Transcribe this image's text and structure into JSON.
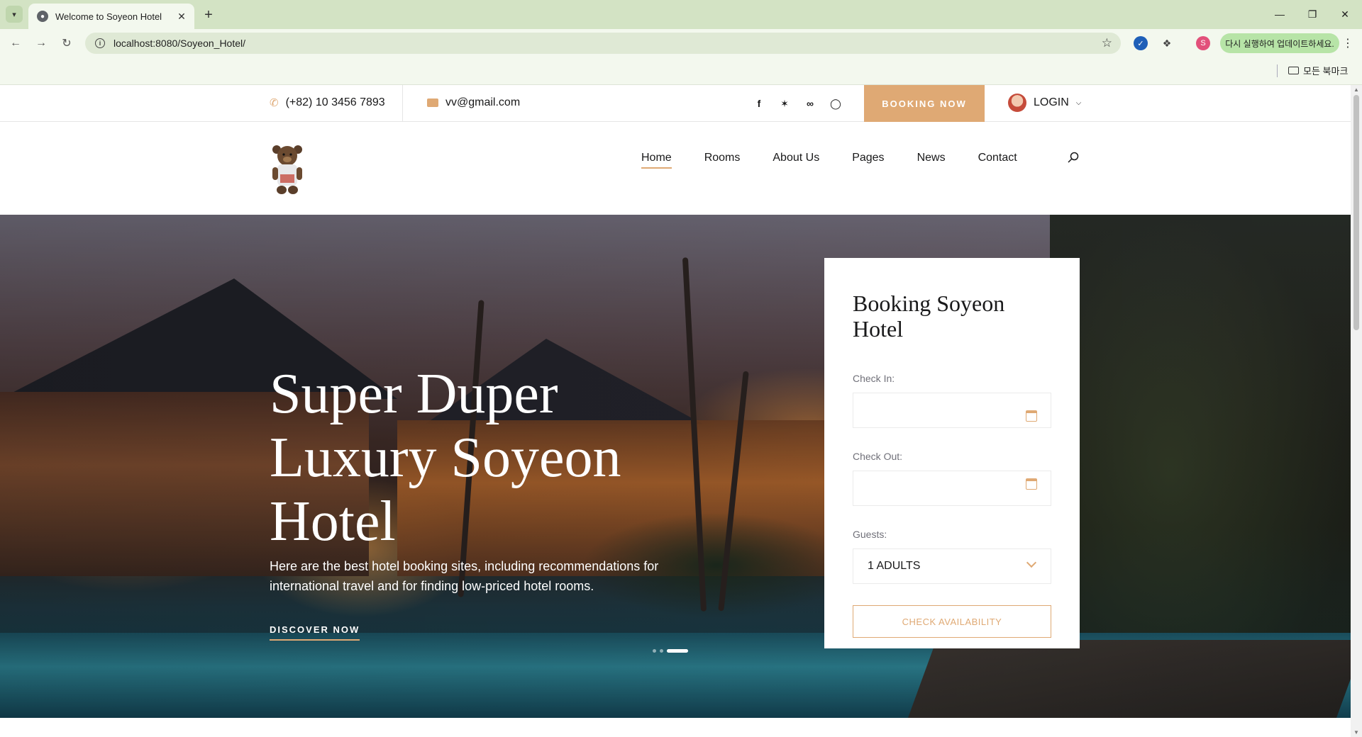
{
  "browser": {
    "tab_title": "Welcome to Soyeon Hotel",
    "url": "localhost:8080/Soyeon_Hotel/",
    "profile_initial": "S",
    "update_pill": "다시 실행하여 업데이트하세요.",
    "bookmarks_all": "모든 북마크"
  },
  "top_header": {
    "phone": "(+82) 10 3456 7893",
    "email": "vv@gmail.com",
    "socials": [
      "facebook-icon",
      "twitter-icon",
      "tripadvisor-icon",
      "instagram-icon"
    ],
    "booking_now": "BOOKING NOW",
    "login": "LOGIN"
  },
  "nav": {
    "items": [
      {
        "label": "Home",
        "active": true
      },
      {
        "label": "Rooms"
      },
      {
        "label": "About Us"
      },
      {
        "label": "Pages"
      },
      {
        "label": "News"
      },
      {
        "label": "Contact"
      }
    ]
  },
  "hero": {
    "title": "Super Duper Luxury Soyeon Hotel",
    "description": "Here are the best hotel booking sites, including recommendations for international travel and for finding low-priced hotel rooms.",
    "cta": "DISCOVER NOW",
    "slides": 3,
    "active_slide": 3
  },
  "booking": {
    "title": "Booking Soyeon Hotel",
    "check_in_label": "Check In:",
    "check_in_value": "",
    "check_out_label": "Check Out:",
    "check_out_value": "",
    "guests_label": "Guests:",
    "guests_value": "1 ADULTS",
    "button": "CHECK AVAILABILITY"
  },
  "colors": {
    "accent": "#dfa974",
    "text": "#19191a"
  }
}
